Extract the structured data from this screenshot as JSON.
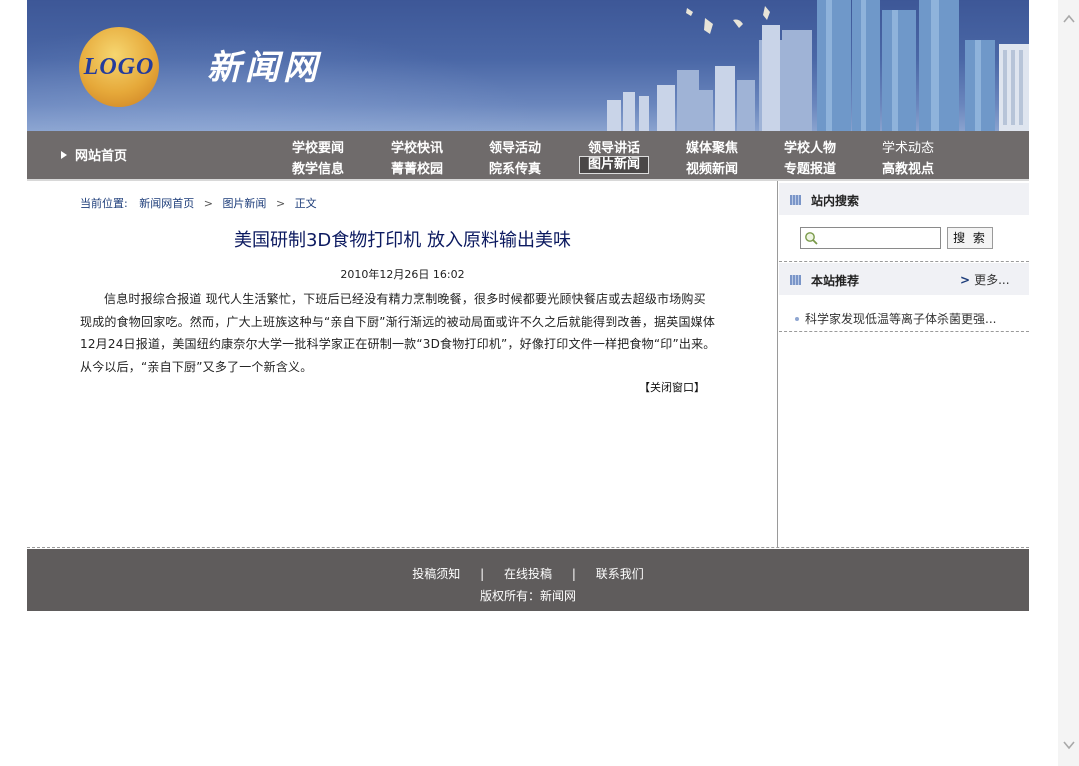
{
  "header": {
    "logo_text": "LOGO",
    "site_title": "新闻网"
  },
  "nav": {
    "home": "网站首页",
    "row1": [
      "学校要闻",
      "学校快讯",
      "领导活动",
      "领导讲话",
      "媒体聚焦",
      "学校人物",
      "学术动态"
    ],
    "row2": [
      "教学信息",
      "菁菁校园",
      "院系传真",
      "图片新闻",
      "视频新闻",
      "专题报道",
      "高教视点"
    ],
    "active": "图片新闻"
  },
  "breadcrumb": {
    "prefix": "当前位置:",
    "items": [
      "新闻网首页",
      "图片新闻",
      "正文"
    ]
  },
  "article": {
    "title": "美国研制3D食物打印机 放入原料输出美味",
    "date": "2010年12月26日 16:02",
    "body": "信息时报综合报道 现代人生活繁忙，下班后已经没有精力烹制晚餐，很多时候都要光顾快餐店或去超级市场购买现成的食物回家吃。然而，广大上班族这种与“亲自下厨”渐行渐远的被动局面或许不久之后就能得到改善，据英国媒体12月24日报道，美国纽约康奈尔大学一批科学家正在研制一款“3D食物打印机”，好像打印文件一样把食物“印”出来。从今以后，“亲自下厨”又多了一个新含义。",
    "close_label": "【关闭窗口】"
  },
  "sidebar": {
    "search_title": "站内搜索",
    "search_value": "",
    "search_button": "搜 索",
    "rec_title": "本站推荐",
    "more_label": "更多...",
    "rec_item": "科学家发现低温等离子体杀菌更强..."
  },
  "footer": {
    "links": [
      "投稿须知",
      "在线投稿",
      "联系我们"
    ],
    "separator": "|",
    "copyright": "版权所有：新闻网"
  },
  "colors": {
    "nav_bg": "#6f6b6b",
    "footer_bg": "#5f5c5c",
    "title_color": "#0c1a60",
    "link_color": "#1d3d7a"
  },
  "icons": {
    "scroll_up": "chevron-up-icon",
    "scroll_down": "chevron-down-icon",
    "search": "magnifier-icon",
    "home_arrow": "triangle-right-icon"
  }
}
